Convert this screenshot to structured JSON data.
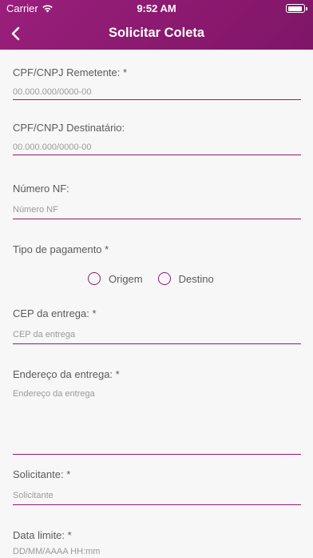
{
  "status_bar": {
    "carrier": "Carrier",
    "time": "9:52 AM"
  },
  "nav": {
    "title": "Solicitar Coleta",
    "back_icon": "chevron-left-icon"
  },
  "colors": {
    "header": "#8c1a70",
    "accent": "#8f1a72",
    "background": "#f7f7f7"
  },
  "form": {
    "cpf_remetente": {
      "label": "CPF/CNPJ Remetente: *",
      "placeholder": "00.000.000/0000-00",
      "value": ""
    },
    "cpf_destinatario": {
      "label": "CPF/CNPJ Destinatário:",
      "placeholder": "00.000.000/0000-00",
      "value": ""
    },
    "numero_nf": {
      "label": "Número NF:",
      "placeholder": "Número NF",
      "value": ""
    },
    "tipo_pagamento": {
      "label": "Tipo de pagamento *",
      "options": [
        "Origem",
        "Destino"
      ]
    },
    "cep_entrega": {
      "label": "CEP da entrega: *",
      "placeholder": "CEP da entrega",
      "value": ""
    },
    "endereco_entrega": {
      "label": "Endereço da entrega: *",
      "placeholder": "Endereço da entrega",
      "value": ""
    },
    "solicitante": {
      "label": "Solicitante: *",
      "placeholder": "Solicitante",
      "value": ""
    },
    "data_limite": {
      "label": "Data limite: *",
      "placeholder": "DD/MM/AAAA HH:mm",
      "value": ""
    }
  }
}
